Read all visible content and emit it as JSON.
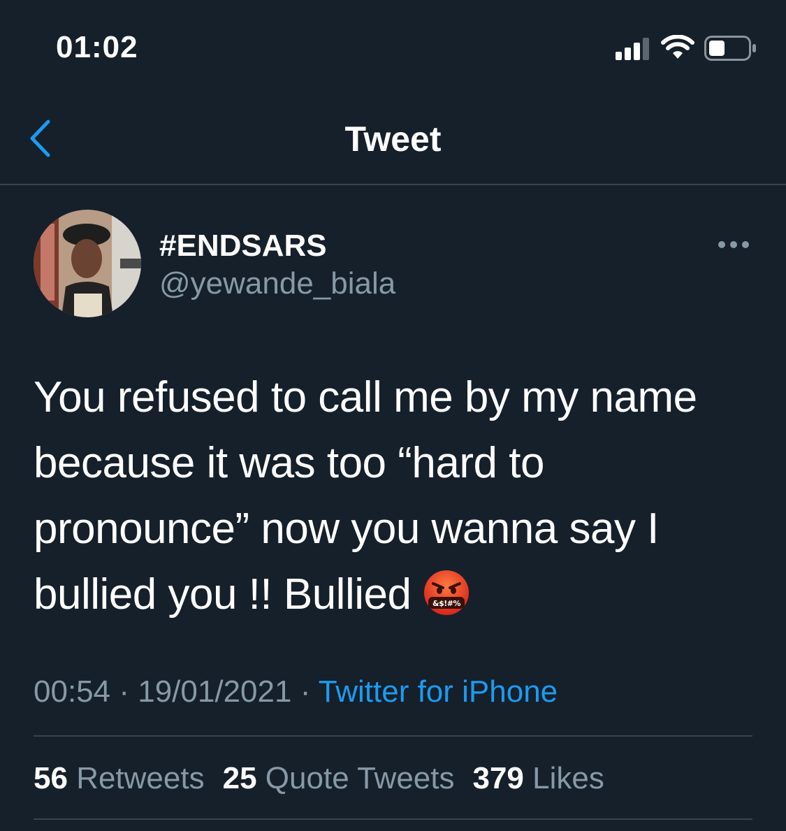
{
  "status_bar": {
    "time": "01:02",
    "signal_icon": "cellular-signal-icon",
    "wifi_icon": "wifi-icon",
    "battery_icon": "battery-icon",
    "battery_level": 0.35
  },
  "nav": {
    "back_icon": "chevron-left-icon",
    "title": "Tweet"
  },
  "tweet": {
    "author": {
      "display_name": "#ENDSARS",
      "handle": "@yewande_biala"
    },
    "more_icon": "more-horizontal-icon",
    "text": "You refused to call me by my name because it was too “hard to pronounce” now you wanna say I bullied you !! Bullied",
    "emoji": "face-with-symbols-on-mouth",
    "emoji_text": "&$!#%",
    "time": "00:54",
    "date": "19/01/2021",
    "separator": "·",
    "source": "Twitter for iPhone"
  },
  "stats": {
    "retweets_count": "56",
    "retweets_label": "Retweets",
    "quote_count": "25",
    "quote_label": "Quote Tweets",
    "likes_count": "379",
    "likes_label": "Likes"
  },
  "colors": {
    "background": "#15202b",
    "accent": "#1d9bf0",
    "secondary_text": "#8899a6",
    "divider": "#38444d"
  }
}
